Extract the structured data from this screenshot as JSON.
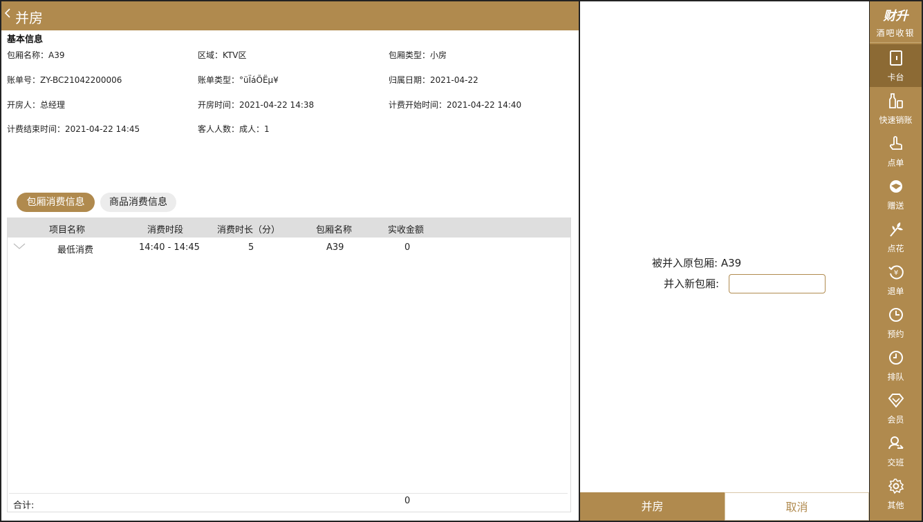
{
  "header": {
    "back_icon": "chevron-left-icon",
    "title": "并房"
  },
  "basic_info": {
    "title": "基本信息",
    "room_name": "包厢名称：A39",
    "area": "区域：KTV区",
    "room_type": "包厢类型：小房",
    "bill_no": "账单号：ZY-BC21042200006",
    "bill_type": "账单类型：°üÏáÕËµ¥",
    "belong_date": "归属日期：2021-04-22",
    "opener": "开房人：总经理",
    "open_time": "开房时间：2021-04-22 14:38",
    "billing_start": "计费开始时间：2021-04-22 14:40",
    "billing_end": "计费结束时间：2021-04-22 14:45",
    "guests": "客人人数：成人：1"
  },
  "tabs": {
    "room": "包厢消费信息",
    "goods": "商品消费信息"
  },
  "table": {
    "headers": [
      "项目名称",
      "消费时段",
      "消费时长（分）",
      "包厢名称",
      "实收金额"
    ],
    "rows": [
      {
        "name": "最低消费",
        "period": "14:40 - 14:45",
        "duration": "5",
        "room": "A39",
        "amount": "0"
      }
    ],
    "total_label": "合计:",
    "total_value": "0"
  },
  "merge": {
    "original_label": "被并入原包厢:",
    "original_value": "A39",
    "new_label": "并入新包厢:",
    "new_value": ""
  },
  "buttons": {
    "confirm": "并房",
    "cancel": "取消"
  },
  "sidebar": {
    "brand_name": "财升",
    "brand_sub": "酒吧收银",
    "items": [
      {
        "label": "卡台",
        "icon": "door-icon"
      },
      {
        "label": "快速销账",
        "icon": "bottle-icon"
      },
      {
        "label": "点单",
        "icon": "finger-icon"
      },
      {
        "label": "赠送",
        "icon": "gift-icon"
      },
      {
        "label": "点花",
        "icon": "flower-icon"
      },
      {
        "label": "退单",
        "icon": "refund-icon"
      },
      {
        "label": "预约",
        "icon": "clock-icon"
      },
      {
        "label": "排队",
        "icon": "queue-icon"
      },
      {
        "label": "会员",
        "icon": "diamond-icon"
      },
      {
        "label": "交班",
        "icon": "shift-icon"
      },
      {
        "label": "其他",
        "icon": "gear-icon"
      }
    ]
  },
  "colors": {
    "accent": "#b08a4e",
    "accent_dark": "#8c6a34",
    "header_row": "#dedede"
  }
}
